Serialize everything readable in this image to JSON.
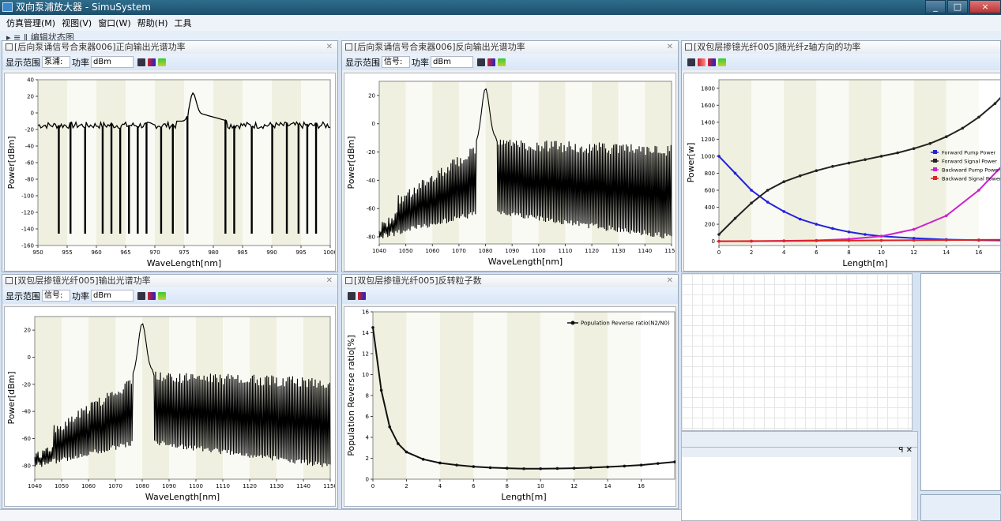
{
  "window": {
    "title": "双向泵浦放大器 - SimuSystem",
    "buttons": [
      "_",
      "□",
      "×"
    ]
  },
  "menubar": [
    "仿真管理(M)",
    "视图(V)",
    "窗口(W)",
    "帮助(H)",
    "工具"
  ],
  "toolstrip_text": "编辑状态图",
  "colors": {
    "pump_forward": "#2222dd",
    "signal_forward": "#222222",
    "pump_backward": "#cc22cc",
    "signal_backward": "#dd2222",
    "plot_band": "#f0f0e0"
  },
  "panels": [
    {
      "title": "[后向泵诵信号合束器006]正向输出光谱功率",
      "toolbar": {
        "range_label": "显示范围",
        "range_value": "泵浦:",
        "power_label": "功率",
        "power_unit": "dBm"
      }
    },
    {
      "title": "[后向泵诵信号合束器006]反向输出光谱功率",
      "toolbar": {
        "range_label": "显示范围",
        "range_value": "信号:",
        "power_label": "功率",
        "power_unit": "dBm"
      }
    },
    {
      "title": "[双包层掺镱光纤005]随光纤z轴方向的功率"
    },
    {
      "title": "[双包层掺镱光纤005]输出光谱功率",
      "toolbar": {
        "range_label": "显示范围",
        "range_value": "信号:",
        "power_label": "功率",
        "power_unit": "dBm"
      }
    },
    {
      "title": "[双包层掺镱光纤005]反转粒子数"
    }
  ],
  "chart_data": [
    {
      "type": "line",
      "xlabel": "WaveLength[nm]",
      "ylabel": "Power[dBm]",
      "xlim": [
        950,
        1000
      ],
      "ylim": [
        -160,
        40
      ],
      "x_ticks": [
        "950",
        "955",
        "960",
        "965",
        "970",
        "975",
        "980",
        "985",
        "990",
        "995",
        "1000"
      ],
      "y_ticks": [
        "40",
        "20",
        "0",
        "-20",
        "-40",
        "-60",
        "-80",
        "-100",
        "-120",
        "-140",
        "-160"
      ],
      "peak": {
        "x": 976.5,
        "y": 24
      },
      "noise_floor": -15,
      "dropouts": [
        953.5,
        955.5,
        958,
        961,
        962.5,
        964,
        965.5,
        967,
        968.5,
        971,
        973,
        975.5,
        982,
        983.5,
        986.5,
        990,
        992.5,
        994.5,
        996,
        997.5
      ]
    },
    {
      "type": "line",
      "xlabel": "WaveLength[nm]",
      "ylabel": "Power[dBm]",
      "xlim": [
        1040,
        1150
      ],
      "ylim": [
        -85,
        30
      ],
      "x_ticks": [
        "1040",
        "1050",
        "1060",
        "1070",
        "1080",
        "1090",
        "1100",
        "1110",
        "1120",
        "1130",
        "1140",
        "1150"
      ],
      "y_ticks": [
        "20",
        "0",
        "-20",
        "-40",
        "-60",
        "-80"
      ],
      "peak": {
        "x": 1080,
        "y": 25
      }
    },
    {
      "type": "line",
      "xlabel": "Length[m]",
      "ylabel": "Power[w]",
      "xlim": [
        0,
        18
      ],
      "ylim": [
        -50,
        1900
      ],
      "x_ticks": [
        "0",
        "2",
        "4",
        "6",
        "8",
        "10",
        "12",
        "14",
        "16"
      ],
      "y_ticks": [
        "1800",
        "1600",
        "1400",
        "1200",
        "1000",
        "800",
        "600",
        "400",
        "200",
        "0"
      ],
      "legend": [
        "Forward Pump Power",
        "Forward Signal Power",
        "Backward Pump Power",
        "Backward Signal Power"
      ],
      "legend_position": "right",
      "series": [
        {
          "name": "Forward Pump Power",
          "x": [
            0,
            1,
            2,
            3,
            4,
            5,
            6,
            7,
            8,
            9,
            10,
            12,
            14,
            16,
            18
          ],
          "values": [
            1000,
            800,
            600,
            460,
            350,
            260,
            200,
            150,
            110,
            80,
            60,
            35,
            20,
            12,
            8
          ]
        },
        {
          "name": "Forward Signal Power",
          "x": [
            0,
            1,
            2,
            3,
            4,
            5,
            6,
            7,
            8,
            9,
            10,
            11,
            12,
            13,
            14,
            15,
            16,
            17,
            18
          ],
          "values": [
            80,
            270,
            450,
            600,
            700,
            770,
            830,
            880,
            920,
            960,
            1000,
            1040,
            1090,
            1150,
            1230,
            1330,
            1460,
            1620,
            1820
          ]
        },
        {
          "name": "Backward Pump Power",
          "x": [
            0,
            2,
            4,
            6,
            8,
            10,
            12,
            14,
            16,
            18
          ],
          "values": [
            0,
            0,
            5,
            10,
            25,
            60,
            140,
            300,
            600,
            1000
          ]
        },
        {
          "name": "Backward Signal Power",
          "x": [
            0,
            2,
            4,
            6,
            8,
            10,
            12,
            14,
            16,
            18
          ],
          "values": [
            0,
            2,
            4,
            6,
            8,
            10,
            12,
            14,
            16,
            18
          ]
        }
      ]
    },
    {
      "type": "line",
      "xlabel": "WaveLength[nm]",
      "ylabel": "Power[dBm]",
      "xlim": [
        1040,
        1150
      ],
      "ylim": [
        -90,
        30
      ],
      "x_ticks": [
        "1040",
        "1050",
        "1060",
        "1070",
        "1080",
        "1090",
        "1100",
        "1110",
        "1120",
        "1130",
        "1140",
        "1150"
      ],
      "y_ticks": [
        "20",
        "0",
        "-20",
        "-40",
        "-60",
        "-80"
      ],
      "peak": {
        "x": 1080,
        "y": 25
      }
    },
    {
      "type": "line",
      "xlabel": "Length[m]",
      "ylabel": "Population Reverse ratio[%]",
      "xlim": [
        0,
        18
      ],
      "ylim": [
        0,
        16
      ],
      "x_ticks": [
        "0",
        "2",
        "4",
        "6",
        "8",
        "10",
        "12",
        "14",
        "16"
      ],
      "y_ticks": [
        "16",
        "14",
        "12",
        "10",
        "8",
        "6",
        "4",
        "2",
        "0"
      ],
      "legend": [
        "Population  Reverse ratio(N2/N0)"
      ],
      "legend_position": "top-right",
      "series": [
        {
          "name": "Population  Reverse ratio(N2/N0)",
          "x": [
            0,
            0.5,
            1,
            1.5,
            2,
            3,
            4,
            5,
            6,
            7,
            8,
            9,
            10,
            11,
            12,
            13,
            14,
            15,
            16,
            17,
            18
          ],
          "values": [
            14.5,
            8.5,
            5.0,
            3.4,
            2.6,
            1.9,
            1.55,
            1.35,
            1.2,
            1.1,
            1.05,
            1.0,
            1.0,
            1.02,
            1.05,
            1.1,
            1.17,
            1.25,
            1.35,
            1.5,
            1.65
          ]
        }
      ]
    }
  ]
}
